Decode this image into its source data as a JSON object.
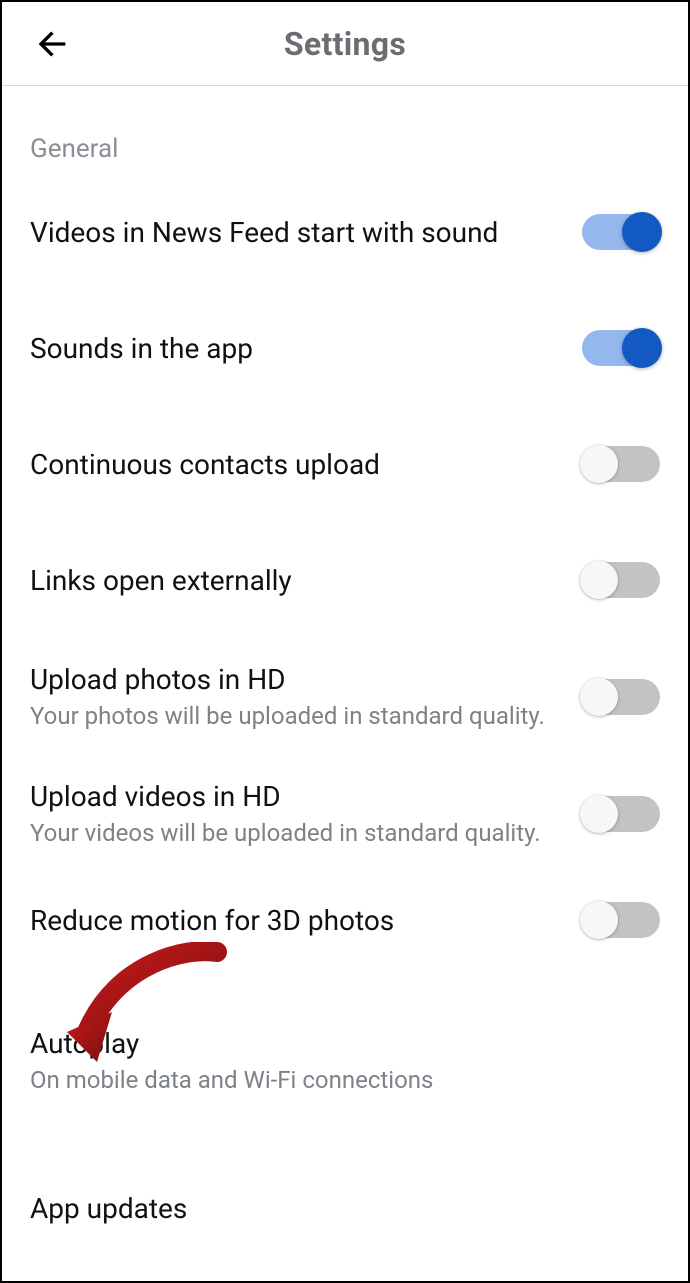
{
  "header": {
    "title": "Settings"
  },
  "section_label": "General",
  "items": [
    {
      "title": "Videos in News Feed start with sound",
      "sub": null,
      "toggle": true,
      "state": "on"
    },
    {
      "title": "Sounds in the app",
      "sub": null,
      "toggle": true,
      "state": "on"
    },
    {
      "title": "Continuous contacts upload",
      "sub": null,
      "toggle": true,
      "state": "off"
    },
    {
      "title": "Links open externally",
      "sub": null,
      "toggle": true,
      "state": "off"
    },
    {
      "title": "Upload photos in HD",
      "sub": "Your photos will be uploaded in standard quality.",
      "toggle": true,
      "state": "off"
    },
    {
      "title": "Upload videos in HD",
      "sub": "Your videos will be uploaded in standard quality.",
      "toggle": true,
      "state": "off"
    },
    {
      "title": "Reduce motion for 3D photos",
      "sub": null,
      "toggle": true,
      "state": "off"
    },
    {
      "title": "Autoplay",
      "sub": "On mobile data and Wi-Fi connections",
      "toggle": false
    },
    {
      "title": "App updates",
      "sub": null,
      "toggle": false
    }
  ],
  "annotation": {
    "type": "red-arrow",
    "points_to": "Autoplay"
  }
}
